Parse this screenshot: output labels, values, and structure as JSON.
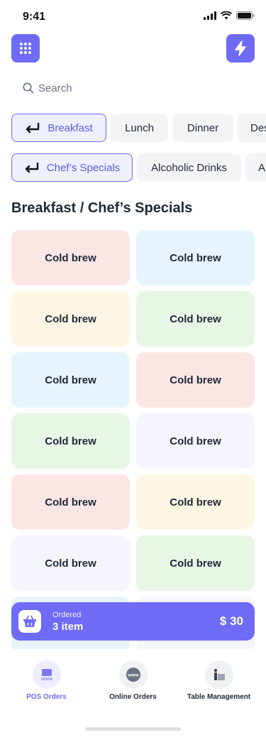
{
  "status": {
    "time": "9:41"
  },
  "search": {
    "placeholder": "Search"
  },
  "categories": [
    {
      "label": "Breakfast",
      "active": true
    },
    {
      "label": "Lunch",
      "active": false
    },
    {
      "label": "Dinner",
      "active": false
    },
    {
      "label": "Desserts",
      "active": false
    }
  ],
  "subcategories": [
    {
      "label": "Chef’s Specials",
      "active": true
    },
    {
      "label": "Alcoholic Drinks",
      "active": false
    },
    {
      "label": "Alcohol-free",
      "active": false
    }
  ],
  "section_title": "Breakfast / Chef’s Specials",
  "products": [
    {
      "name": "Cold brew",
      "color": "#fbe6e6"
    },
    {
      "name": "Cold brew",
      "color": "#e6f4fd"
    },
    {
      "name": "Cold brew",
      "color": "#fef6e4"
    },
    {
      "name": "Cold brew",
      "color": "#e8f6e6"
    },
    {
      "name": "Cold brew",
      "color": "#e6f4fd"
    },
    {
      "name": "Cold brew",
      "color": "#fbe6e6"
    },
    {
      "name": "Cold brew",
      "color": "#e8f6e6"
    },
    {
      "name": "Cold brew",
      "color": "#f5f5fe"
    },
    {
      "name": "Cold brew",
      "color": "#fbe6e6"
    },
    {
      "name": "Cold brew",
      "color": "#fef6e4"
    },
    {
      "name": "Cold brew",
      "color": "#f5f5fe"
    },
    {
      "name": "Cold brew",
      "color": "#e8f6e6"
    },
    {
      "name": "",
      "color": "#e6f4fd"
    },
    {
      "name": "",
      "color": "#f5f5fe"
    }
  ],
  "order": {
    "label": "Ordered",
    "count": "3 item",
    "total": "$ 30"
  },
  "nav": [
    {
      "label": "POS Orders",
      "icon": "pos-icon",
      "active": true
    },
    {
      "label": "Online Orders",
      "icon": "globe-www-icon",
      "active": false
    },
    {
      "label": "Table Management",
      "icon": "table-icon",
      "active": false
    }
  ],
  "colors": {
    "accent": "#6e6bf6",
    "chip_bg": "#f3f4f6",
    "chip_active_bg": "#eef0ff"
  }
}
